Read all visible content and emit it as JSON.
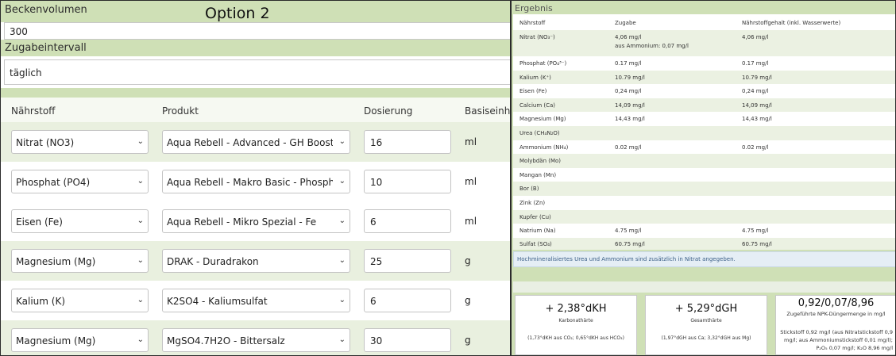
{
  "left": {
    "volume_label": "Beckenvolumen",
    "option_title": "Option 2",
    "volume_value": "300",
    "interval_label": "Zugabeintervall",
    "interval_value": "täglich",
    "columns": [
      "Nährstoff",
      "Produkt",
      "Dosierung",
      "Basiseinheit"
    ],
    "rows": [
      {
        "nutrient": "Nitrat (NO3)",
        "product": "Aqua Rebell - Advanced - GH Boost N",
        "dose": "16",
        "unit": "ml"
      },
      {
        "nutrient": "Phosphat (PO4)",
        "product": "Aqua Rebell - Makro Basic - Phosphat",
        "dose": "10",
        "unit": "ml"
      },
      {
        "nutrient": "Eisen (Fe)",
        "product": "Aqua Rebell - Mikro Spezial - Fe",
        "dose": "6",
        "unit": "ml"
      },
      {
        "nutrient": "Magnesium (Mg)",
        "product": "DRAK - Duradrakon",
        "dose": "25",
        "unit": "g"
      },
      {
        "nutrient": "Kalium (K)",
        "product": "K2SO4 - Kaliumsulfat",
        "dose": "6",
        "unit": "g"
      },
      {
        "nutrient": "Magnesium (Mg)",
        "product": "MgSO4.7H2O - Bittersalz",
        "dose": "30",
        "unit": "g"
      }
    ]
  },
  "result": {
    "title": "Ergebnis",
    "columns": [
      "Nährstoff",
      "Zugabe",
      "Nährstoffgehalt (inkl. Wasserwerte)"
    ],
    "rows": [
      {
        "nutrient": "Nitrat (NO₃⁻)",
        "added": "4,06 mg/l",
        "sub": "aus Ammonium: 0,07 mg/l",
        "content": "4,06 mg/l"
      },
      {
        "nutrient": "Phosphat (PO₄³⁻)",
        "added": "0.17 mg/l",
        "content": "0.17 mg/l"
      },
      {
        "nutrient": "Kalium (K⁺)",
        "added": "10.79 mg/l",
        "content": "10.79 mg/l"
      },
      {
        "nutrient": "Eisen (Fe)",
        "added": "0,24 mg/l",
        "content": "0,24 mg/l"
      },
      {
        "nutrient": "Calcium (Ca)",
        "added": "14,09 mg/l",
        "content": "14,09 mg/l"
      },
      {
        "nutrient": "Magnesium (Mg)",
        "added": "14,43 mg/l",
        "content": "14,43 mg/l"
      },
      {
        "nutrient": "Urea (CH₄N₂O)",
        "added": "",
        "content": ""
      },
      {
        "nutrient": "Ammonium (NH₄)",
        "added": "0.02 mg/l",
        "content": "0.02 mg/l"
      },
      {
        "nutrient": "Molybdän (Mo)",
        "added": "",
        "content": ""
      },
      {
        "nutrient": "Mangan (Mn)",
        "added": "",
        "content": ""
      },
      {
        "nutrient": "Bor (B)",
        "added": "",
        "content": ""
      },
      {
        "nutrient": "Zink (Zn)",
        "added": "",
        "content": ""
      },
      {
        "nutrient": "Kupfer (Cu)",
        "added": "",
        "content": ""
      },
      {
        "nutrient": "Natrium (Na)",
        "added": "4.75 mg/l",
        "content": "4.75 mg/l"
      },
      {
        "nutrient": "Sulfat (SO₄)",
        "added": "60.75 mg/l",
        "content": "60.75 mg/l"
      }
    ],
    "note": "Hochmineralisiertes Urea und Ammonium sind zusätzlich in Nitrat angegeben.",
    "kh": {
      "value": "+ 2,38°dKH",
      "caption": "Karbonathärte",
      "detail": "(1,73°dKH aus CO₂; 0,65°dKH aus HCO₃)"
    },
    "gh": {
      "value": "+ 5,29°dGH",
      "caption": "Gesamthärte",
      "detail": "(1,97°dGH aus Ca; 3,32°dGH aus Mg)"
    },
    "npk": {
      "value": "0,92/0,07/8,96",
      "caption": "Zugeführte NPK-Düngermenge in mg/l",
      "detail": "Stickstoff 0,92 mg/l (aus Nitratstickstoff 0,9 mg/l; aus Ammoniumstickstoff 0,01 mg/l); P₂O₅ 0,07 mg/l; K₂O 8,96 mg/l"
    }
  }
}
